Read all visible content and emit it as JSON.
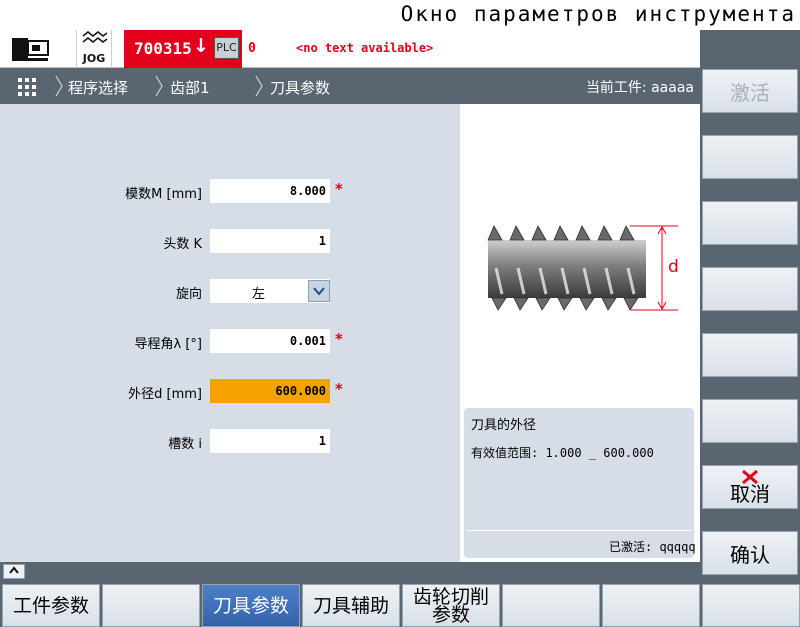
{
  "caption": "Окно параметров инструмента",
  "status": {
    "mode": "JOG",
    "alarm_code": "700315",
    "plc_label": "PLC",
    "alarm_count": "0",
    "alarm_text": "<no text available>"
  },
  "breadcrumb": {
    "items": [
      "程序选择",
      "齿部1",
      "刀具参数"
    ],
    "workpiece": "当前工件: aaaaa"
  },
  "form": {
    "module_label": "模数M [mm]",
    "module_value": "8.000",
    "starts_label": "头数 K",
    "starts_value": "1",
    "direction_label": "旋向",
    "direction_value": "左",
    "lead_label": "导程角λ [°]",
    "lead_value": "0.001",
    "diameter_label": "外径d [mm]",
    "diameter_value": "600.000",
    "flutes_label": "槽数 i",
    "flutes_value": "1",
    "required_mark": "*"
  },
  "help": {
    "image_label": "d",
    "title": "刀具的外径",
    "range": "有效值范围: 1.000 _ 600.000",
    "activated": "已激活: qqqqq"
  },
  "vertical_keys": {
    "activate": "激活",
    "cancel": "取消",
    "confirm": "确认"
  },
  "horizontal_keys": {
    "workpiece_params": "工件参数",
    "tool_params": "刀具参数",
    "tool_aux": "刀具辅助",
    "gear_cutting_line1": "齿轮切削",
    "gear_cutting_line2": "参数"
  },
  "colors": {
    "alarm": "#e3001b",
    "active_field": "#f5a200",
    "active_key": "#3d6fb8",
    "panel": "#d5dde7",
    "bar": "#5a6572"
  }
}
